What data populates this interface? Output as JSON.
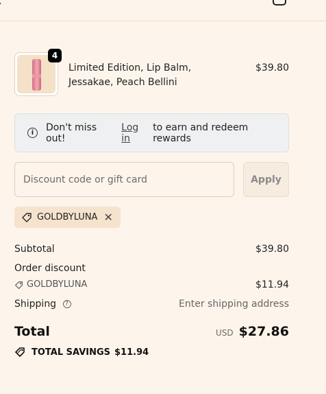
{
  "product": {
    "quantity": "4",
    "title": "Limited Edition, Lip Balm, Jessakae, Peach Bellini",
    "price": "$39.80",
    "icon": "lip-balm-product-image"
  },
  "notice": {
    "prefix": "Don't miss out!",
    "link": "Log in",
    "suffix": "to earn and redeem rewards",
    "icon": "info-icon"
  },
  "discount": {
    "placeholder": "Discount code or gift card",
    "value": "",
    "apply_label": "Apply"
  },
  "applied_code": {
    "code": "GOLDBYLUNA",
    "icon": "tag-icon",
    "remove_icon": "close-icon"
  },
  "summary": {
    "subtotal_label": "Subtotal",
    "subtotal_value": "$39.80",
    "order_discount_label": "Order discount",
    "order_discount_code": "GOLDBYLUNA",
    "order_discount_value": "$11.94",
    "shipping_label": "Shipping",
    "shipping_value": "Enter shipping address",
    "total_label": "Total",
    "currency": "USD",
    "total_value": "$27.86",
    "savings_label": "TOTAL SAVINGS",
    "savings_value": "$11.94"
  },
  "colors": {
    "background": "#fdf5ec",
    "notice_background": "#eef0f1",
    "chip_background": "#f6e3cd",
    "apply_background": "#f7ece0"
  }
}
